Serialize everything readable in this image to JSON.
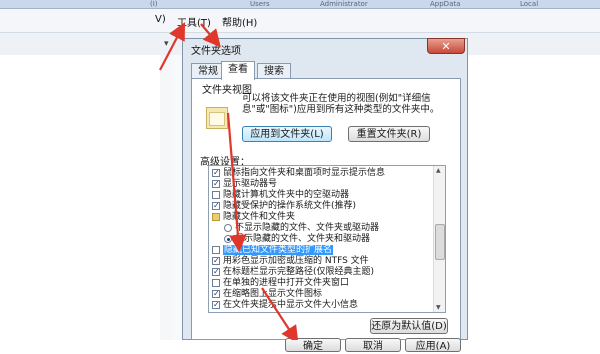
{
  "explorer": {
    "path_segments": [
      "(I)",
      "Users",
      "Administrator",
      "AppData",
      "Local"
    ],
    "menu": [
      {
        "label": "V)"
      },
      {
        "label": "工具(T)"
      },
      {
        "label": "帮助(H)"
      }
    ]
  },
  "dialog": {
    "title": "文件夹选项",
    "close_symbol": "✕",
    "tabs": [
      {
        "label": "常规",
        "active": false
      },
      {
        "label": "查看",
        "active": true
      },
      {
        "label": "搜索",
        "active": false
      }
    ],
    "folder_view": {
      "group_title": "文件夹视图",
      "description": "可以将该文件夹正在使用的视图(例如\"详细信息\"或\"图标\")应用到所有这种类型的文件夹中。",
      "apply_button": "应用到文件夹(L)",
      "reset_button": "重置文件夹(R)"
    },
    "advanced": {
      "group_title": "高级设置：",
      "items": [
        {
          "type": "checkbox",
          "checked": true,
          "indent": 0,
          "label": "鼠标指向文件夹和桌面项时显示提示信息"
        },
        {
          "type": "checkbox",
          "checked": true,
          "indent": 0,
          "label": "显示驱动器号"
        },
        {
          "type": "checkbox",
          "checked": false,
          "indent": 0,
          "label": "隐藏计算机文件夹中的空驱动器"
        },
        {
          "type": "checkbox",
          "checked": true,
          "indent": 0,
          "label": "隐藏受保护的操作系统文件(推荐)"
        },
        {
          "type": "folder",
          "checked": false,
          "indent": 0,
          "label": "隐藏文件和文件夹"
        },
        {
          "type": "radio",
          "checked": false,
          "indent": 1,
          "label": "不显示隐藏的文件、文件夹或驱动器"
        },
        {
          "type": "radio",
          "checked": true,
          "indent": 1,
          "label": "显示隐藏的文件、文件夹和驱动器"
        },
        {
          "type": "checkbox",
          "checked": false,
          "indent": 0,
          "label": "隐藏已知文件类型的扩展名",
          "highlight": true
        },
        {
          "type": "checkbox",
          "checked": true,
          "indent": 0,
          "label": "用彩色显示加密或压缩的 NTFS 文件"
        },
        {
          "type": "checkbox",
          "checked": true,
          "indent": 0,
          "label": "在标题栏显示完整路径(仅限经典主题)"
        },
        {
          "type": "checkbox",
          "checked": false,
          "indent": 0,
          "label": "在单独的进程中打开文件夹窗口"
        },
        {
          "type": "checkbox",
          "checked": true,
          "indent": 0,
          "label": "在缩略图上显示文件图标"
        },
        {
          "type": "checkbox",
          "checked": true,
          "indent": 0,
          "label": "在文件夹提示中显示文件大小信息"
        }
      ],
      "restore_button": "还原为默认值(D)"
    },
    "footer": {
      "ok": "确定",
      "cancel": "取消",
      "apply": "应用(A)"
    }
  },
  "annotation_color": "#e0362b"
}
